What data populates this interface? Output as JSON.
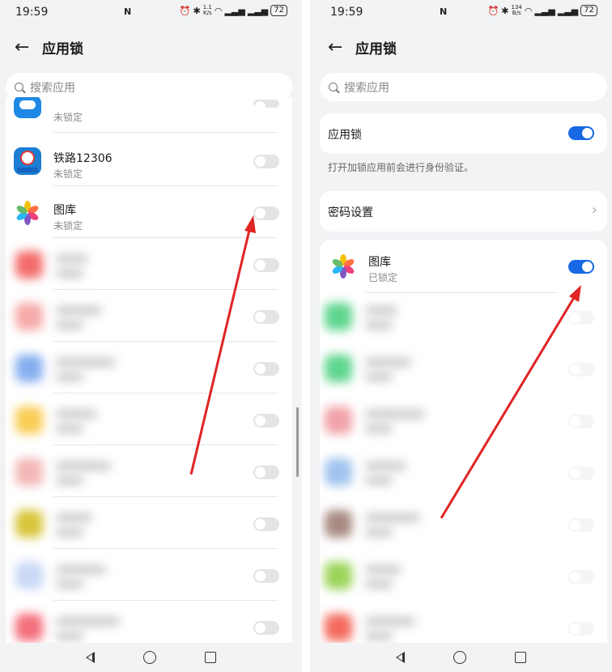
{
  "status_bar": {
    "time": "19:59",
    "nfc": "N",
    "left_speed_value": "1.1",
    "left_speed_unit": "K/s",
    "right_speed_value": "134",
    "right_speed_unit": "B/s",
    "battery": "72"
  },
  "header": {
    "back_icon": "arrow-left-icon",
    "title": "应用锁"
  },
  "search": {
    "placeholder": "搜索应用"
  },
  "left_list": [
    {
      "name": "",
      "status": "未锁定",
      "icon": "cloud-icon",
      "color": "#1e88e5",
      "locked": false
    },
    {
      "name": "铁路12306",
      "status": "未锁定",
      "icon": "railway-icon",
      "color": "#1a7fd4",
      "locked": false
    },
    {
      "name": "图库",
      "status": "未锁定",
      "icon": "gallery-icon",
      "color": "#ffffff",
      "locked": false
    }
  ],
  "left_blurred_colors": [
    "#f36b6b",
    "#f7a9a9",
    "#86aeef",
    "#f9cd54",
    "#f3b6b6",
    "#d8c53a",
    "#c9d8f5",
    "#f46f7c"
  ],
  "app_lock": {
    "label": "应用锁",
    "enabled": true,
    "description": "打开加锁应用前会进行身份验证。"
  },
  "password_settings": {
    "label": "密码设置",
    "chevron_icon": "chevron-right-icon"
  },
  "right_list": [
    {
      "name": "图库",
      "status": "已锁定",
      "icon": "gallery-icon",
      "locked": true
    }
  ],
  "right_blurred_colors": [
    "#5fd58e",
    "#5fd58e",
    "#f1a1a8",
    "#9fc3ee",
    "#a88a82",
    "#9cd45a",
    "#f46b5e"
  ],
  "annotation": {
    "arrow_color": "#e02424"
  },
  "navigation": {
    "back_icon": "triangle-back-icon",
    "home_icon": "circle-home-icon",
    "recent_icon": "square-recent-icon"
  }
}
